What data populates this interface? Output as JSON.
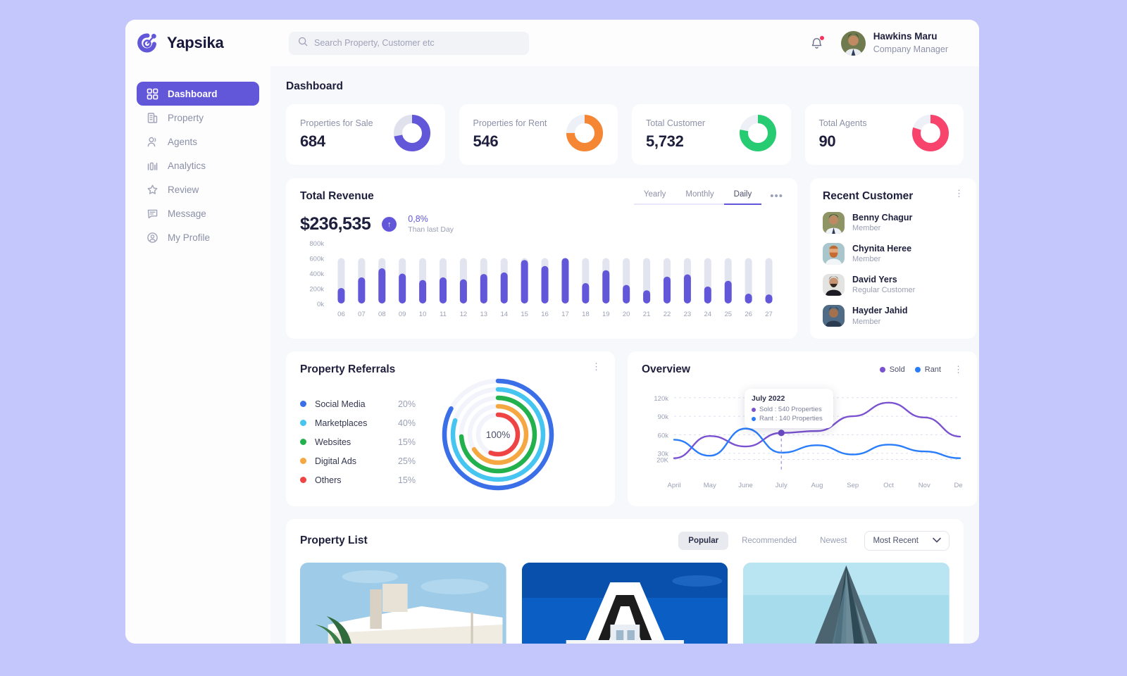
{
  "brand": {
    "name": "Yapsika",
    "logo_icon": "yapsika-swirl-logo",
    "accent": "#6257d9"
  },
  "search": {
    "placeholder": "Search Property, Customer etc",
    "value": "",
    "icon": "search-icon"
  },
  "header": {
    "bell_icon": "notification-bell-icon",
    "has_notification": true,
    "user": {
      "name": "Hawkins Maru",
      "role": "Company Manager"
    }
  },
  "sidebar": {
    "items": [
      {
        "label": "Dashboard",
        "icon": "grid-icon",
        "active": true
      },
      {
        "label": "Property",
        "icon": "building-icon",
        "active": false
      },
      {
        "label": "Agents",
        "icon": "people-icon",
        "active": false
      },
      {
        "label": "Analytics",
        "icon": "bar-chart-icon",
        "active": false
      },
      {
        "label": "Review",
        "icon": "star-icon",
        "active": false
      },
      {
        "label": "Message",
        "icon": "chat-icon",
        "active": false
      },
      {
        "label": "My Profile",
        "icon": "user-circle-icon",
        "active": false
      }
    ]
  },
  "page": {
    "title": "Dashboard"
  },
  "stats": [
    {
      "label": "Properties for Sale",
      "value": "684",
      "color": "#6257d9",
      "track": "#dfe1ec",
      "pct": 72
    },
    {
      "label": "Properties for Rent",
      "value": "546",
      "color": "#f58634",
      "track": "#eef0f8",
      "pct": 75
    },
    {
      "label": "Total Customer",
      "value": "5,732",
      "color": "#27cc72",
      "track": "#eef0f8",
      "pct": 78
    },
    {
      "label": "Total Agents",
      "value": "90",
      "color": "#f8436d",
      "track": "#eef0f8",
      "pct": 80
    }
  ],
  "revenue": {
    "title": "Total Revenue",
    "amount": "$236,535",
    "trend_pct": "0,8%",
    "trend_sub": "Than last Day",
    "trend_icon": "arrow-up-icon",
    "menu_icon": "more-horizontal-icon",
    "tabs": [
      {
        "label": "Yearly",
        "active": false
      },
      {
        "label": "Monthly",
        "active": false
      },
      {
        "label": "Daily",
        "active": true
      }
    ]
  },
  "recent_customer": {
    "title": "Recent Customer",
    "menu_icon": "more-vertical-icon",
    "customers": [
      {
        "name": "Benny Chagur",
        "role": "Member",
        "avatar_bg": "#8f9465"
      },
      {
        "name": "Chynita Heree",
        "role": "Member",
        "avatar_bg": "#a9c6cd"
      },
      {
        "name": "David Yers",
        "role": "Regular Customer",
        "avatar_bg": "#e3e3e1"
      },
      {
        "name": "Hayder Jahid",
        "role": "Member",
        "avatar_bg": "#4f6b86"
      }
    ]
  },
  "referrals": {
    "title": "Property Referrals",
    "menu_icon": "more-vertical-icon",
    "center_label": "100%"
  },
  "overview": {
    "title": "Overview",
    "menu_icon": "more-vertical-icon",
    "legend": [
      {
        "label": "Sold",
        "color": "#7a52d1"
      },
      {
        "label": "Rant",
        "color": "#2a7dfa"
      }
    ],
    "tooltip": {
      "title": "July 2022",
      "rows": [
        {
          "label": "Sold : 540 Properties",
          "color": "#7a52d1"
        },
        {
          "label": "Rant : 140 Properties",
          "color": "#2a7dfa"
        }
      ]
    }
  },
  "property_list": {
    "title": "Property List",
    "tabs": [
      {
        "label": "Popular",
        "active": true
      },
      {
        "label": "Recommended",
        "active": false
      },
      {
        "label": "Newest",
        "active": false
      }
    ],
    "sort": {
      "value": "Most Recent",
      "icon": "chevron-down-icon"
    },
    "items": [
      {
        "name": "villa-modern-pool",
        "c1": "#9ecbe8",
        "c2": "#e9e4d8"
      },
      {
        "name": "white-house-blue-sky",
        "c1": "#0a5ec4",
        "c2": "#f2f4f6"
      },
      {
        "name": "glass-tower",
        "c1": "#a7dcec",
        "c2": "#3e5b68"
      }
    ]
  },
  "chart_data": [
    {
      "type": "bar",
      "title": "Total Revenue",
      "xlabel": "",
      "ylabel": "",
      "categories": [
        "06",
        "07",
        "08",
        "09",
        "10",
        "11",
        "12",
        "13",
        "14",
        "15",
        "16",
        "17",
        "18",
        "19",
        "20",
        "21",
        "22",
        "23",
        "24",
        "25",
        "26",
        "27"
      ],
      "values": [
        205000,
        345000,
        465000,
        395000,
        310000,
        345000,
        320000,
        390000,
        410000,
        575000,
        495000,
        600000,
        270000,
        440000,
        245000,
        175000,
        355000,
        385000,
        225000,
        300000,
        130000,
        120000
      ],
      "track_max": 600000,
      "ylim": [
        0,
        800000
      ],
      "yticks": [
        0,
        200000,
        400000,
        600000,
        800000
      ],
      "ytick_labels": [
        "0k",
        "200k",
        "400k",
        "600k",
        "800k"
      ],
      "grid": false,
      "bar_color": "#6257d9",
      "track_color": "#e2e5ef"
    },
    {
      "type": "pie",
      "title": "Property Referrals",
      "labels": [
        "Social Media",
        "Marketplaces",
        "Websites",
        "Digital Ads",
        "Others"
      ],
      "values": [
        20,
        40,
        15,
        25,
        15
      ],
      "value_labels": [
        "20%",
        "40%",
        "15%",
        "25%",
        "15%"
      ],
      "colors": [
        "#3b6fe8",
        "#45c5ef",
        "#22b14c",
        "#f5a742",
        "#ee4444"
      ],
      "center": "100%",
      "legend": "left"
    },
    {
      "type": "line",
      "title": "Overview",
      "x": [
        "April",
        "May",
        "June",
        "July",
        "Aug",
        "Sep",
        "Oct",
        "Nov",
        "Dec"
      ],
      "series": [
        {
          "name": "Sold",
          "color": "#7a52d1",
          "values": [
            22000,
            58000,
            41000,
            63000,
            66000,
            90000,
            112000,
            88000,
            57000
          ]
        },
        {
          "name": "Rant",
          "color": "#2a7dfa",
          "values": [
            52000,
            26000,
            70000,
            31000,
            43000,
            28000,
            44000,
            33000,
            22000
          ]
        }
      ],
      "ylim": [
        20000,
        120000
      ],
      "yticks": [
        20000,
        30000,
        60000,
        90000,
        120000
      ],
      "ytick_labels": [
        "20K",
        "30k",
        "60k",
        "90k",
        "120k"
      ],
      "grid": true,
      "legend": "top-right",
      "highlight_x": "July"
    }
  ]
}
